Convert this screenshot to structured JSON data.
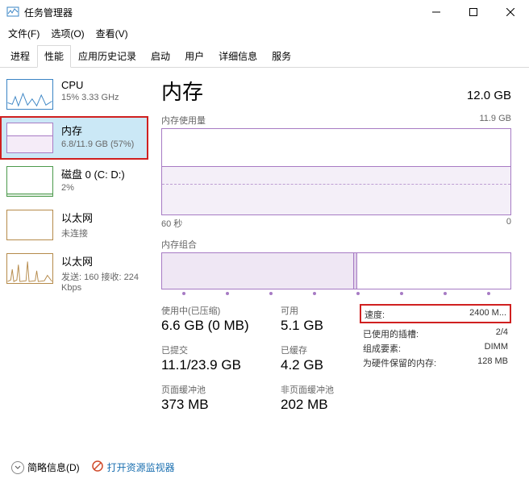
{
  "window": {
    "title": "任务管理器"
  },
  "menu": {
    "file": "文件(F)",
    "options": "选项(O)",
    "view": "查看(V)"
  },
  "tabs": [
    "进程",
    "性能",
    "应用历史记录",
    "启动",
    "用户",
    "详细信息",
    "服务"
  ],
  "activeTab": 1,
  "sidebar": {
    "items": [
      {
        "name": "CPU",
        "sub": "15% 3.33 GHz"
      },
      {
        "name": "内存",
        "sub": "6.8/11.9 GB (57%)"
      },
      {
        "name": "磁盘 0 (C: D:)",
        "sub": "2%"
      },
      {
        "name": "以太网",
        "sub": "未连接"
      },
      {
        "name": "以太网",
        "sub": "发送: 160 接收: 224 Kbps"
      }
    ]
  },
  "main": {
    "title": "内存",
    "total": "12.0 GB",
    "usageLabel": "内存使用量",
    "usageMax": "11.9 GB",
    "timeLabel": "60 秒",
    "timeRight": "0",
    "compLabel": "内存组合",
    "stats": {
      "inuse_label": "使用中(已压缩)",
      "inuse_value": "6.6 GB (0 MB)",
      "avail_label": "可用",
      "avail_value": "5.1 GB",
      "commit_label": "已提交",
      "commit_value": "11.1/23.9 GB",
      "cached_label": "已缓存",
      "cached_value": "4.2 GB",
      "paged_label": "页面缓冲池",
      "paged_value": "373 MB",
      "nonpaged_label": "非页面缓冲池",
      "nonpaged_value": "202 MB"
    },
    "details": [
      {
        "label": "速度:",
        "value": "2400 M..."
      },
      {
        "label": "已使用的插槽:",
        "value": "2/4"
      },
      {
        "label": "组成要素:",
        "value": "DIMM"
      },
      {
        "label": "为硬件保留的内存:",
        "value": "128 MB"
      }
    ]
  },
  "footer": {
    "fewer": "简略信息(D)",
    "resmon": "打开资源监视器"
  }
}
